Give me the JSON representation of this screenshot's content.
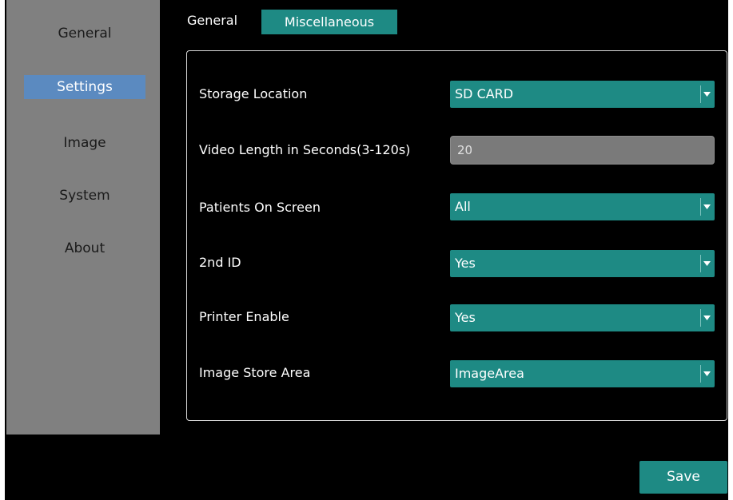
{
  "sidebar": {
    "items": [
      {
        "label": "General"
      },
      {
        "label": "Settings"
      },
      {
        "label": "Image"
      },
      {
        "label": "System"
      },
      {
        "label": "About"
      }
    ],
    "active": "Settings"
  },
  "tabs": [
    {
      "label": "General"
    },
    {
      "label": "Miscellaneous"
    }
  ],
  "active_tab": "Miscellaneous",
  "form": {
    "storage_location": {
      "label": "Storage Location",
      "value": "SD CARD"
    },
    "video_length": {
      "label": "Video Length in Seconds(3-120s)",
      "value": "20"
    },
    "patients_on_screen": {
      "label": "Patients On Screen",
      "value": "All"
    },
    "second_id": {
      "label": "2nd ID",
      "value": "Yes"
    },
    "printer_enable": {
      "label": "Printer Enable",
      "value": "Yes"
    },
    "image_store_area": {
      "label": "Image Store Area",
      "value": "ImageArea"
    }
  },
  "actions": {
    "save_label": "Save"
  },
  "colors": {
    "accent": "#1e8a84",
    "sidebar_bg": "#808080",
    "sidebar_active": "#5b8ac0",
    "background": "#000000"
  },
  "icons": {
    "dropdown": "triangle-down-icon"
  }
}
